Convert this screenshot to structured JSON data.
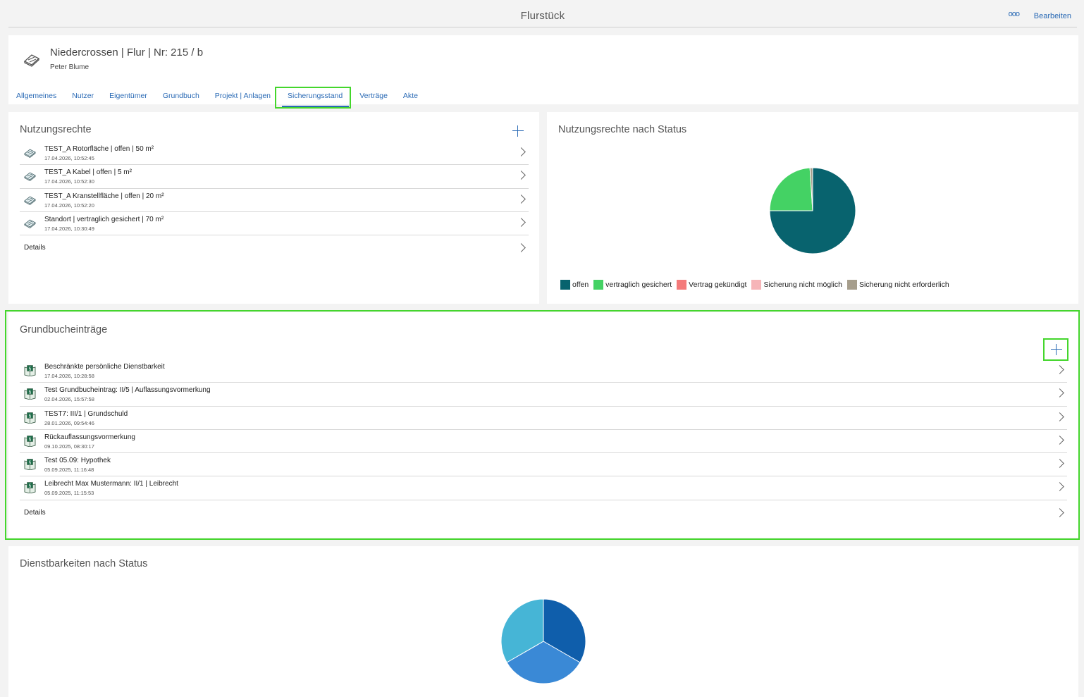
{
  "topbar": {
    "title": "Flurstück",
    "more": "ooo",
    "edit": "Bearbeiten"
  },
  "header": {
    "name": "Niedercrossen | Flur | Nr: 215 / b",
    "owner": "Peter Blume",
    "tabs": [
      "Allgemeines",
      "Nutzer",
      "Eigentümer",
      "Grundbuch",
      "Projekt | Anlagen",
      "Sicherungsstand",
      "Verträge",
      "Akte"
    ],
    "active_tab": "Sicherungsstand"
  },
  "nutzungsrechte": {
    "title": "Nutzungsrechte",
    "items": [
      {
        "title": "TEST_A Rotorfläche | offen | 50 m²",
        "date": "17.04.2026, 10:52:45"
      },
      {
        "title": "TEST_A Kabel | offen | 5 m²",
        "date": "17.04.2026, 10:52:30"
      },
      {
        "title": "TEST_A Kranstellfläche | offen | 20 m²",
        "date": "17.04.2026, 10:52:20"
      },
      {
        "title": "Standort | vertraglich gesichert | 70 m²",
        "date": "17.04.2026, 10:30:49"
      }
    ],
    "details": "Details"
  },
  "status_chart": {
    "title": "Nutzungsrechte nach Status",
    "legend": [
      {
        "label": "offen",
        "color": "#08636e"
      },
      {
        "label": "vertraglich gesichert",
        "color": "#44d264"
      },
      {
        "label": "Vertrag gekündigt",
        "color": "#f47a7a"
      },
      {
        "label": "Sicherung nicht möglich",
        "color": "#f6b5b8"
      },
      {
        "label": "Sicherung nicht erforderlich",
        "color": "#a69e8c"
      }
    ]
  },
  "grundbuch": {
    "title": "Grundbucheinträge",
    "items": [
      {
        "title": "Beschränkte persönliche Dienstbarkeit",
        "date": "17.04.2026, 10:28:58"
      },
      {
        "title": "Test Grundbucheintrag: II/5 | Auflassungsvormerkung",
        "date": "02.04.2026, 15:57:58"
      },
      {
        "title": "TEST7: III/1 | Grundschuld",
        "date": "28.01.2026, 09:54:46"
      },
      {
        "title": "Rückauflassungsvormerkung",
        "date": "09.10.2025, 08:30:17"
      },
      {
        "title": "Test 05.09: Hypothek",
        "date": "05.09.2025, 11:16:48"
      },
      {
        "title": "Leibrecht Max Mustermann: II/1 | Leibrecht",
        "date": "05.09.2025, 11:15:53"
      }
    ],
    "details": "Details"
  },
  "dienst_chart": {
    "title": "Dienstbarkeiten nach Status"
  },
  "chart_data": [
    {
      "type": "pie",
      "title": "Nutzungsrechte nach Status",
      "categories": [
        "offen",
        "vertraglich gesichert",
        "Vertrag gekündigt",
        "Sicherung nicht möglich",
        "Sicherung nicht erforderlich"
      ],
      "values": [
        75,
        24,
        0,
        0,
        1
      ],
      "colors": [
        "#08636e",
        "#44d264",
        "#f47a7a",
        "#f6b5b8",
        "#a69e8c"
      ],
      "legend_position": "bottom-left"
    },
    {
      "type": "pie",
      "title": "Dienstbarkeiten nach Status",
      "values": [
        1,
        1,
        1
      ],
      "colors": [
        "#0f5eab",
        "#3a89d6",
        "#46b5d6"
      ]
    }
  ]
}
